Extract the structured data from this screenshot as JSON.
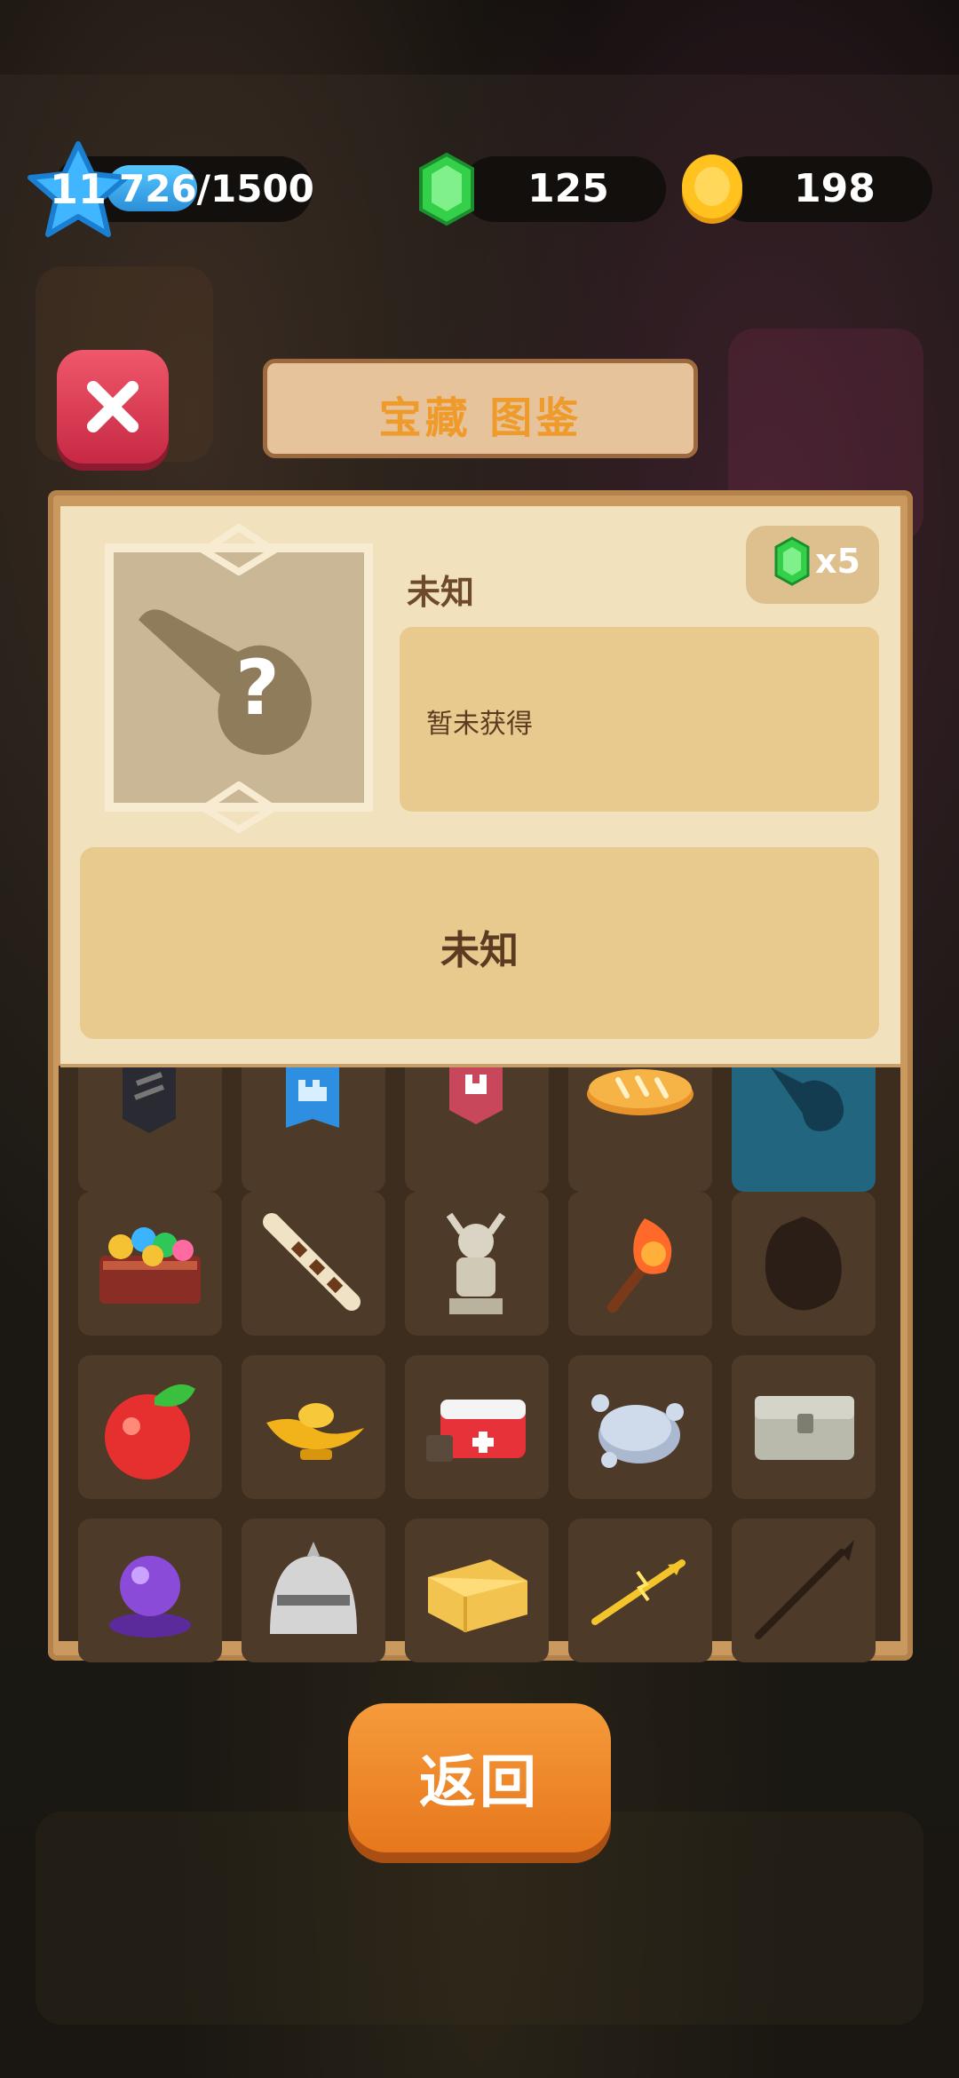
{
  "hud": {
    "level": "11",
    "xp_text": "726/1500",
    "xp_progress": 0.484,
    "gems": "125",
    "coins": "198"
  },
  "header": {
    "title": "宝藏 图鉴"
  },
  "detail": {
    "name": "未知",
    "cost": "x5",
    "description": "暂未获得",
    "info": "未知",
    "portrait_icon": "unknown-guitar-silhouette-icon"
  },
  "collection": {
    "items": [
      "black-banner-icon",
      "blue-castle-banner-icon",
      "red-banner-icon",
      "bread-icon",
      "guitar-silhouette-icon",
      "treasure-chest-gems-icon",
      "flute-icon",
      "knight-statue-icon",
      "torch-icon",
      "locked-silhouette-icon",
      "apple-icon",
      "magic-lamp-icon",
      "first-aid-kit-icon",
      "silver-coins-pile-icon",
      "silver-chest-icon",
      "crystal-ball-icon",
      "knight-helmet-icon",
      "cheese-icon",
      "lightning-arrow-icon",
      "spear-silhouette-icon"
    ]
  },
  "footer": {
    "back_label": "返回"
  }
}
